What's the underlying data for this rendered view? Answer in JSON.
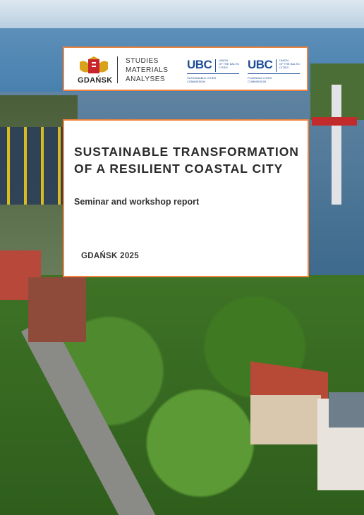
{
  "header": {
    "city_name": "GDAŃSK",
    "series": [
      "STUDIES",
      "MATERIALS",
      "ANALYSES"
    ],
    "logos": [
      {
        "acronym": "UBC",
        "tagline": [
          "UNION",
          "OF THE BALTIC",
          "CITIES"
        ],
        "commission": [
          "SUSTAINABLE CITIES",
          "COMMISSION"
        ]
      },
      {
        "acronym": "UBC",
        "tagline": [
          "UNION",
          "OF THE BALTIC",
          "CITIES"
        ],
        "commission": [
          "PLANNING CITIES",
          "COMMISSION"
        ]
      }
    ]
  },
  "cover": {
    "title_line1": "SUSTAINABLE TRANSFORMATION",
    "title_line2": "OF A RESILIENT COASTAL CITY",
    "subtitle": "Seminar and workshop report",
    "place_year": "GDAŃSK 2025"
  },
  "colors": {
    "frame_accent": "#f0823a",
    "ubc_blue": "#1e4e99"
  }
}
